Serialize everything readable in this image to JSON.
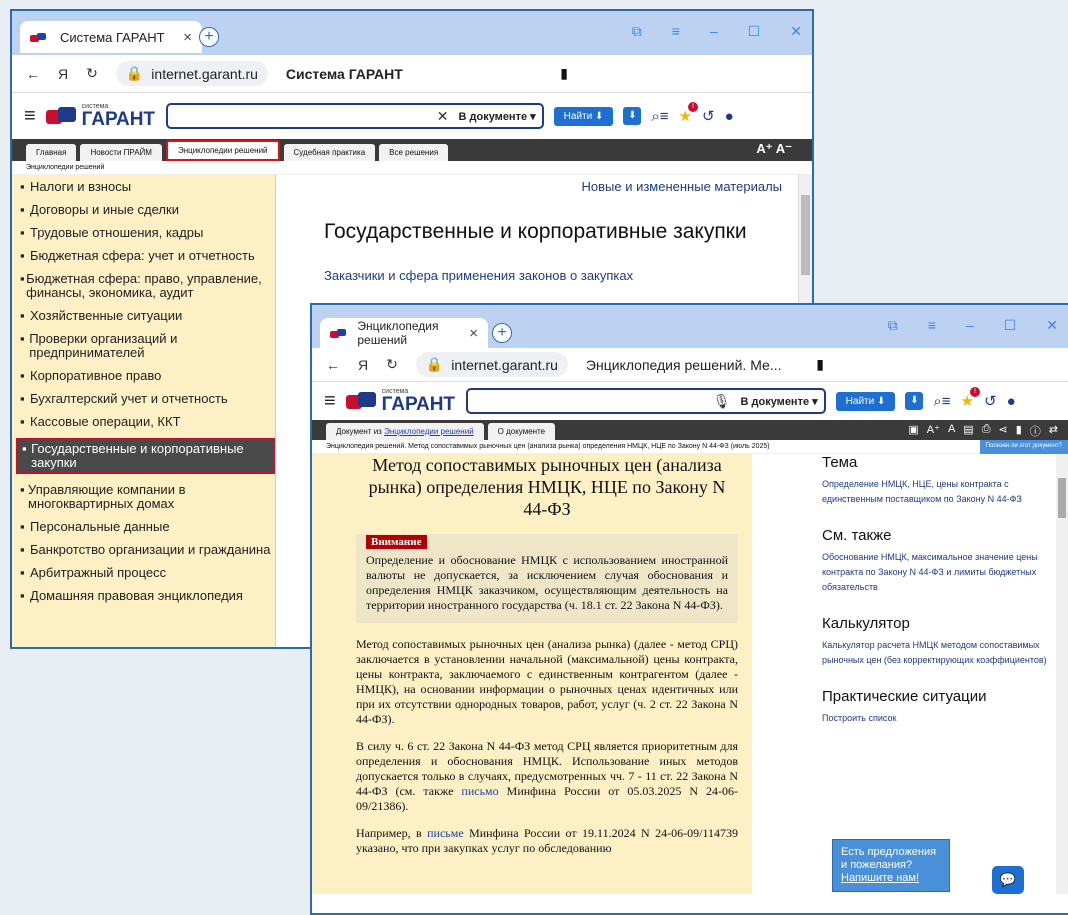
{
  "w1": {
    "tab_title": "Система ГАРАНТ",
    "url": "internet.garant.ru",
    "page_title": "Система ГАРАНТ",
    "logo_small": "система",
    "logo_big": "ГАРАНТ",
    "search_scope": "В документе",
    "find_label": "Найти",
    "nav_tabs": [
      "Главная",
      "Новости ПРАЙМ",
      "Энциклопедии решений",
      "Судебная практика",
      "Все решения"
    ],
    "font_ctl": "A⁺ A⁻",
    "breadcrumb": "Энциклопедии решений",
    "sidebar": [
      "Налоги и взносы",
      "Договоры и иные сделки",
      "Трудовые отношения, кадры",
      "Бюджетная сфера: учет и отчетность",
      "Бюджетная сфера: право, управление, финансы, экономика, аудит",
      "Хозяйственные ситуации",
      "Проверки организаций и предпринимателей",
      "Корпоративное право",
      "Бухгалтерский учет и отчетность",
      "Кассовые операции, ККТ",
      "Государственные и корпоративные закупки",
      "Управляющие компании в многоквартирных домах",
      "Персональные данные",
      "Банкротство организации и гражданина",
      "Арбитражный процесс",
      "Домашняя правовая энциклопедия"
    ],
    "new_materials": "Новые и измененные материалы",
    "heading": "Государственные и корпоративные закупки",
    "sublink": "Заказчики и сфера применения законов о закупках"
  },
  "w2": {
    "tab_title": "Энциклопедия решений",
    "url": "internet.garant.ru",
    "page_title": "Энциклопедия решений. Ме...",
    "logo_small": "система",
    "logo_big": "ГАРАНТ",
    "search_scope": "В документе",
    "find_label": "Найти",
    "tab_doc_prefix": "Документ из ",
    "tab_doc_link": "Энциклопедии решений",
    "tab_about": "О документе",
    "breadcrumb": "Энциклопедия решений. Метод сопоставимых рыночных цен (анализа рынка) определения НМЦК, НЦЕ по Закону N 44-ФЗ (июль 2025)",
    "helpful": "Полезен ли этот документ?",
    "doc_title": "Метод сопоставимых рыночных цен (анализа рынка) определения НМЦК, НЦЕ по Закону N 44-ФЗ",
    "warning_label": "Внимание",
    "warning_text": "Определение и обоснование НМЦК с использованием иностранной валюты не допускается, за исключением случая обоснования и определения НМЦК заказчиком, осуществляющим деятельность на территории иностранного государства (ч. 18.1 ст. 22 Закона N 44-ФЗ).",
    "p1": "Метод сопоставимых рыночных цен (анализа рынка) (далее - метод СРЦ) заключается в установлении начальной (максимальной) цены контракта, цены контракта, заключаемого с единственным контрагентом (далее - НМЦК), на основании информации о рыночных ценах идентичных или при их отсутствии однородных товаров, работ, услуг (ч. 2 ст. 22 Закона N 44-ФЗ).",
    "p2a": "В силу ч. 6 ст. 22 Закона N 44-ФЗ метод СРЦ является приоритетным для определения и обоснования НМЦК. Использование иных методов допускается только в случаях, предусмотренных чч. 7 - 11 ст. 22 Закона N 44-ФЗ (см. также ",
    "p2link": "письмо",
    "p2b": " Минфина России от 05.03.2025 N 24-06-09/21386).",
    "p3a": "Например, в ",
    "p3link": "письме",
    "p3b": " Минфина России от 19.11.2024 N 24-06-09/114739 указано, что при закупках услуг по обследованию",
    "side": [
      {
        "h": "Тема",
        "l": "Определение НМЦК, НЦЕ, цены контракта с единственным поставщиком по Закону N 44-ФЗ"
      },
      {
        "h": "См. также",
        "l": "Обоснование НМЦК, максимальное значение цены контракта по Закону N 44-ФЗ и лимиты бюджетных обязательств"
      },
      {
        "h": "Калькулятор",
        "l": "Калькулятор расчета НМЦК методом сопоставимых рыночных цен (без корректирующих коэффициентов)"
      },
      {
        "h": "Практические ситуации",
        "l": "Построить список"
      }
    ],
    "feedback1": "Есть предложения и пожелания?",
    "feedback2": "Напишите нам!"
  },
  "colors": {
    "accent": "#1e3a8a",
    "brand_red": "#c8102e",
    "sidebar_bg": "#fdf0c4",
    "frame": "#2b6cb0"
  }
}
